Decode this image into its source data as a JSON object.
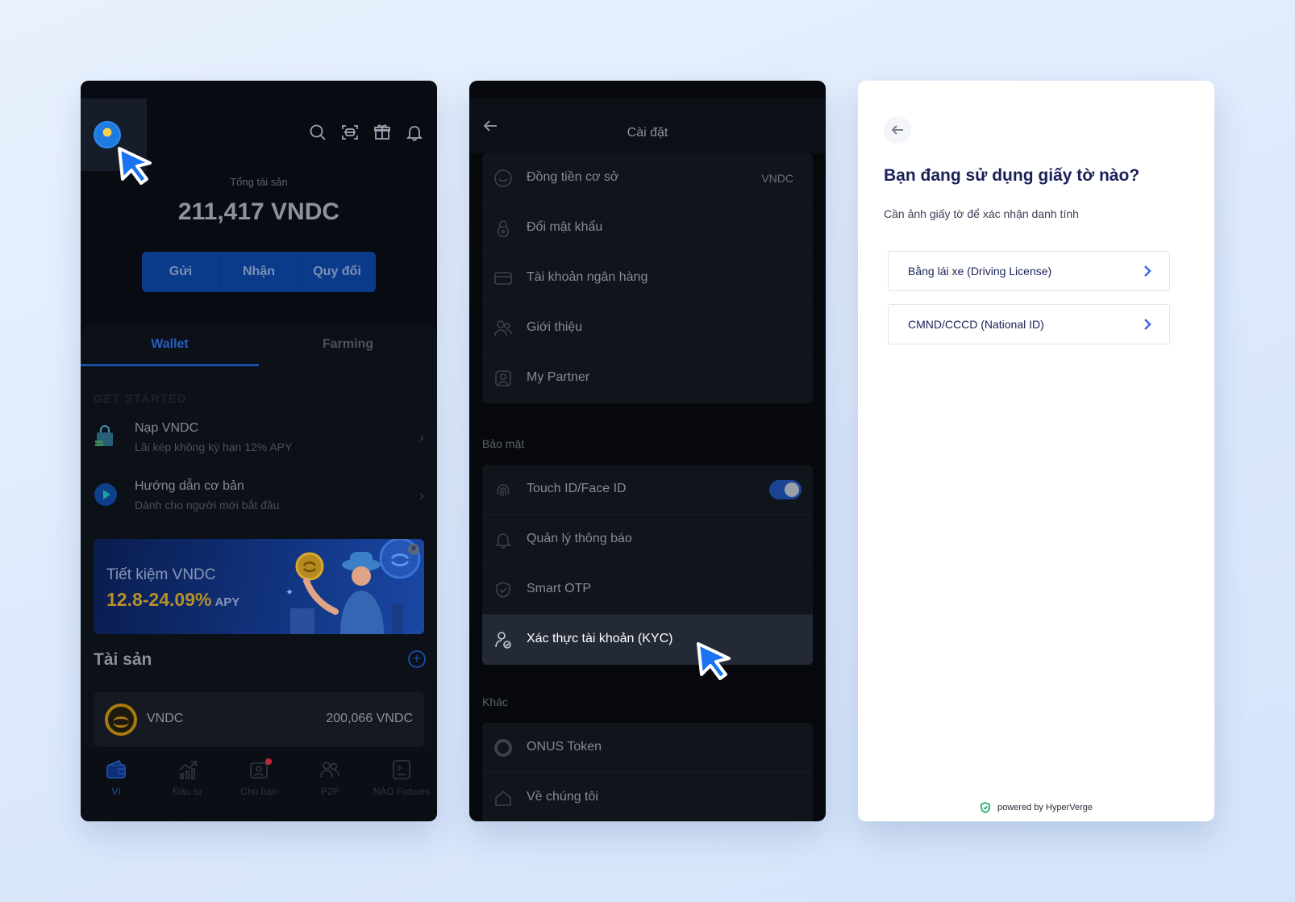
{
  "colors": {
    "background": "#dde9fc",
    "accent_blue": "#1d4fa6",
    "kyc_blue": "#3d67e8",
    "banner_gold": "#b79028"
  },
  "wallet_screen": {
    "top_icons": [
      "search-icon",
      "scan-icon",
      "gift-icon",
      "bell-icon"
    ],
    "total_label": "Tổng tài sản",
    "total_value": "211,417 VNDC",
    "actions": [
      "Gửi",
      "Nhận",
      "Quy đổi"
    ],
    "tabs": [
      "Wallet",
      "Farming"
    ],
    "active_tab": "Wallet",
    "section_label": "GET STARTED",
    "get_started": [
      {
        "title": "Nạp VNDC",
        "subtitle": "Lãi kép không kỳ hạn 12% APY",
        "icon": "shopping-bag-icon"
      },
      {
        "title": "Hướng dẫn cơ bản",
        "subtitle": "Dành cho người mới bắt đầu",
        "icon": "play-icon"
      }
    ],
    "banner": {
      "line1": "Tiết kiệm VNDC",
      "rate": "12.8-24.09%",
      "apy": "APY"
    },
    "assets_title": "Tài sản",
    "asset": {
      "name": "VNDC",
      "value": "200,066 VNDC"
    },
    "bottom_nav": [
      {
        "label": "Ví",
        "icon": "wallet-icon",
        "active": true
      },
      {
        "label": "Đầu tư",
        "icon": "chart-icon",
        "active": false
      },
      {
        "label": "Cho bạn",
        "icon": "gift-box-icon",
        "active": false
      },
      {
        "label": "P2P",
        "icon": "users-icon",
        "active": false
      },
      {
        "label": "NAO Futures",
        "icon": "terminal-icon",
        "active": false
      }
    ]
  },
  "settings_screen": {
    "title": "Cài đặt",
    "general_items": [
      {
        "label": "Đồng tiền cơ sở",
        "value": "VNDC",
        "icon": "coin-icon"
      },
      {
        "label": "Đổi mật khẩu",
        "value": "",
        "icon": "lock-icon"
      },
      {
        "label": "Tài khoản ngân hàng",
        "value": "",
        "icon": "card-icon"
      },
      {
        "label": "Giới thiệu",
        "value": "",
        "icon": "referral-icon"
      },
      {
        "label": "My Partner",
        "value": "",
        "icon": "partner-icon"
      }
    ],
    "security_label": "Bảo mật",
    "security_items": [
      {
        "label": "Touch ID/Face ID",
        "icon": "fingerprint-icon",
        "toggle": true
      },
      {
        "label": "Quản lý thông báo",
        "icon": "bell-icon"
      },
      {
        "label": "Smart OTP",
        "icon": "shield-icon"
      },
      {
        "label": "Xác thực tài khoản (KYC)",
        "icon": "user-check-icon",
        "highlighted": true
      }
    ],
    "other_label": "Khác",
    "other_items": [
      {
        "label": "ONUS Token",
        "icon": "token-icon"
      },
      {
        "label": "Về chúng tôi",
        "icon": "home-icon"
      }
    ]
  },
  "kyc_screen": {
    "title": "Bạn đang sử dụng giấy tờ nào?",
    "subtitle": "Cần ảnh giấy tờ để xác nhận danh tính",
    "options": [
      "Bằng lái xe (Driving License)",
      "CMND/CCCD (National ID)"
    ],
    "powered_by": "powered by HyperVerge"
  }
}
